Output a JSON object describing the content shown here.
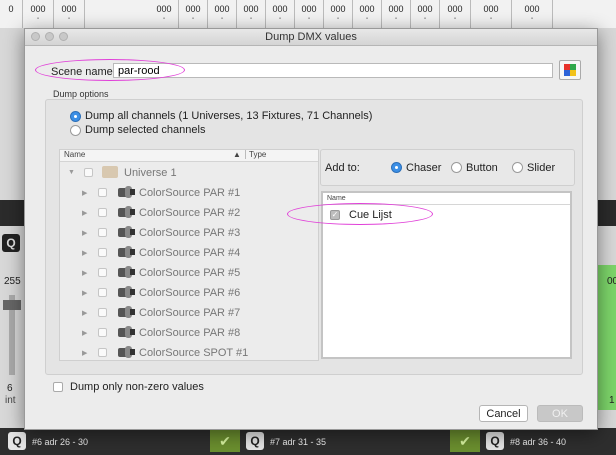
{
  "background": {
    "top_values": [
      "0",
      "000",
      "000",
      "000",
      "000",
      "000",
      "000",
      "000",
      "000",
      "000",
      "000",
      "000",
      "000",
      "000",
      "000",
      "000"
    ],
    "left_top_value": "255",
    "left_bottom_value": "6",
    "left_bottom_unit": "int",
    "right_top_value": "00",
    "right_bottom_value": "1",
    "bottom_bar": [
      {
        "label": "#6 adr 26 - 30"
      },
      {
        "label": "#7 adr 31 - 35"
      },
      {
        "label": "#8 adr 36 - 40"
      }
    ]
  },
  "dialog": {
    "title": "Dump DMX values",
    "scene_name_label": "Scene name:",
    "scene_name_value": "par-rood",
    "group_label": "Dump options",
    "option_all": "Dump all channels (1 Universes, 13 Fixtures, 71 Channels)",
    "option_selected": "Dump selected channels",
    "tree": {
      "col_name": "Name",
      "col_type": "Type",
      "sort_indicator": "▲",
      "universe": "Universe 1",
      "fixtures": [
        "ColorSource PAR #1",
        "ColorSource PAR #2",
        "ColorSource PAR #3",
        "ColorSource PAR #4",
        "ColorSource PAR #5",
        "ColorSource PAR #6",
        "ColorSource PAR #7",
        "ColorSource PAR #8",
        "ColorSource SPOT #1"
      ]
    },
    "add_to_label": "Add to:",
    "add_to_options": [
      "Chaser",
      "Button",
      "Slider"
    ],
    "add_to_selected": "Chaser",
    "target_list": {
      "col_name": "Name",
      "items": [
        {
          "label": "Cue Lijst",
          "checked": true
        }
      ]
    },
    "nonzero_label": "Dump only non-zero values",
    "cancel_label": "Cancel",
    "ok_label": "OK"
  },
  "colors": {
    "annotation": "#e040d8",
    "radio_on": "#3b8fe6",
    "green_fader": "#7dd56a"
  }
}
